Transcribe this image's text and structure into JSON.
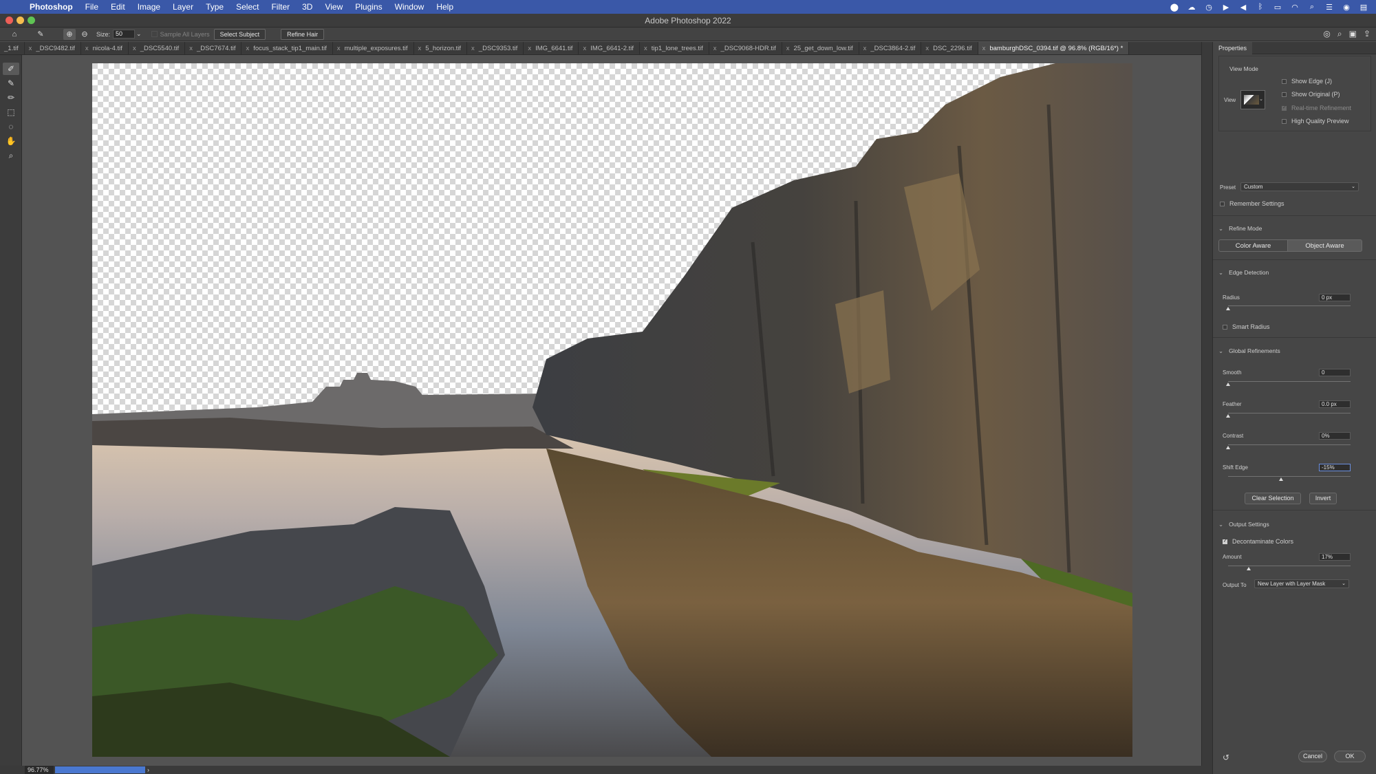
{
  "menubar": {
    "app": "Photoshop",
    "items": [
      "File",
      "Edit",
      "Image",
      "Layer",
      "Type",
      "Select",
      "Filter",
      "3D",
      "View",
      "Plugins",
      "Window",
      "Help"
    ],
    "tray_icons": [
      "location-icon",
      "cloud-icon",
      "time-machine-icon",
      "play-icon",
      "volume-icon",
      "bluetooth-icon",
      "battery-icon",
      "wifi-icon",
      "search-icon",
      "control-center-icon",
      "siri-icon",
      "notification-icon"
    ]
  },
  "window": {
    "title": "Adobe Photoshop 2022"
  },
  "options": {
    "size_label": "Size:",
    "size_value": "50",
    "sample_all_layers": "Sample All Layers",
    "select_subject": "Select Subject",
    "refine_hair": "Refine Hair"
  },
  "tabs": [
    {
      "label": "_1.tif",
      "active": false
    },
    {
      "label": "_DSC9482.tif",
      "active": false
    },
    {
      "label": "nicola-4.tif",
      "active": false
    },
    {
      "label": "_DSC5540.tif",
      "active": false
    },
    {
      "label": "_DSC7674.tif",
      "active": false
    },
    {
      "label": "focus_stack_tip1_main.tif",
      "active": false
    },
    {
      "label": "multiple_exposures.tif",
      "active": false
    },
    {
      "label": "5_horizon.tif",
      "active": false
    },
    {
      "label": "_DSC9353.tif",
      "active": false
    },
    {
      "label": "IMG_6641.tif",
      "active": false
    },
    {
      "label": "IMG_6641-2.tif",
      "active": false
    },
    {
      "label": "tip1_lone_trees.tif",
      "active": false
    },
    {
      "label": "_DSC9068-HDR.tif",
      "active": false
    },
    {
      "label": "25_get_down_low.tif",
      "active": false
    },
    {
      "label": "_DSC3864-2.tif",
      "active": false
    },
    {
      "label": "DSC_2296.tif",
      "active": false
    },
    {
      "label": "bamburghDSC_0394.tif @ 96.8% (RGB/16*) *",
      "active": true
    }
  ],
  "status": {
    "zoom": "96.77%"
  },
  "panel": {
    "title": "Properties",
    "view_mode": {
      "heading": "View Mode",
      "view_label": "View",
      "show_edge": "Show Edge (J)",
      "show_original": "Show Original (P)",
      "realtime": "Real-time Refinement",
      "hq_preview": "High Quality Preview"
    },
    "preset_label": "Preset",
    "preset_value": "Custom",
    "remember": "Remember Settings",
    "refine_mode": {
      "heading": "Refine Mode",
      "color_aware": "Color Aware",
      "object_aware": "Object Aware"
    },
    "edge_detection": {
      "heading": "Edge Detection",
      "radius_label": "Radius",
      "radius_value": "0 px",
      "smart_radius": "Smart Radius"
    },
    "global": {
      "heading": "Global Refinements",
      "smooth_label": "Smooth",
      "smooth_value": "0",
      "feather_label": "Feather",
      "feather_value": "0.0 px",
      "contrast_label": "Contrast",
      "contrast_value": "0%",
      "shift_label": "Shift Edge",
      "shift_value": "-15%",
      "clear_selection": "Clear Selection",
      "invert": "Invert"
    },
    "output": {
      "heading": "Output Settings",
      "decontaminate": "Decontaminate Colors",
      "amount_label": "Amount",
      "amount_value": "17%",
      "output_to_label": "Output To",
      "output_to_value": "New Layer with Layer Mask"
    },
    "cancel": "Cancel",
    "ok": "OK"
  }
}
